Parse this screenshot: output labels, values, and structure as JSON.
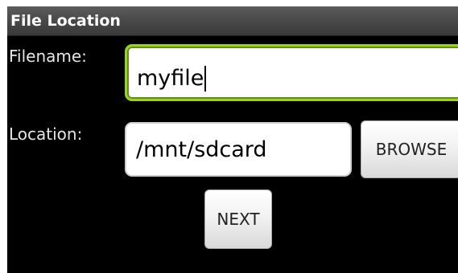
{
  "window": {
    "title": "File Location"
  },
  "form": {
    "filename_label": "Filename:",
    "filename_value": "myfile",
    "location_label": "Location:",
    "location_value": "/mnt/sdcard"
  },
  "buttons": {
    "browse_label": "BROWSE",
    "next_label": "NEXT"
  },
  "colors": {
    "background": "#000000",
    "focus_accent": "#9bd21e",
    "titlebar": "#4a4a4a"
  }
}
